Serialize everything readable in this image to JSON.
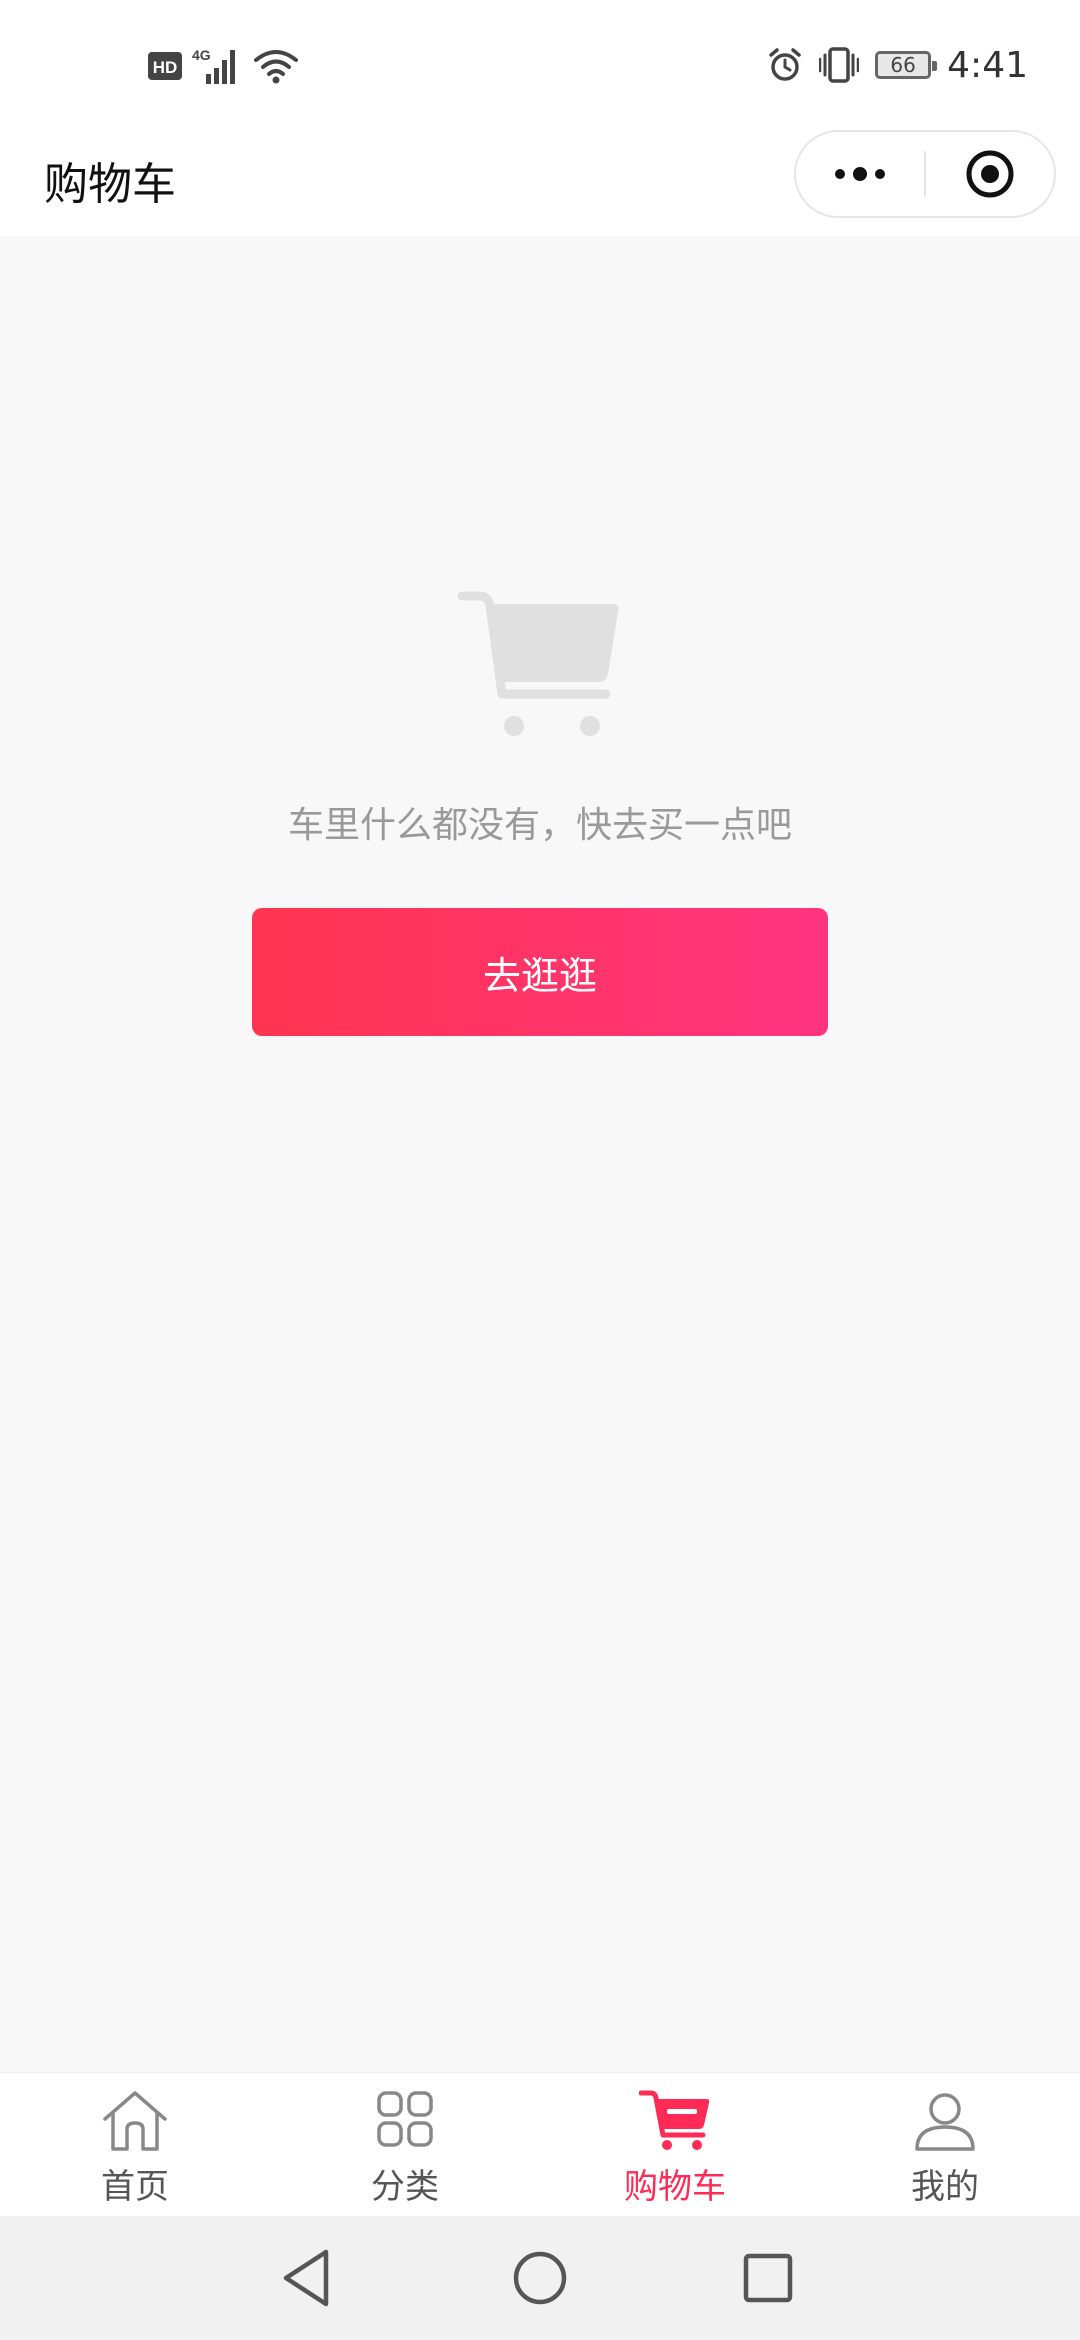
{
  "status_bar": {
    "time": "4:41",
    "battery_level": "66",
    "network_badge": "HD",
    "network_type": "4G",
    "icons": [
      "hd-icon",
      "4g-signal-icon",
      "wifi-icon",
      "alarm-icon",
      "vibrate-icon",
      "battery-icon"
    ]
  },
  "nav": {
    "title": "购物车",
    "capsule_icons": [
      "more-dots-icon",
      "close-target-icon"
    ]
  },
  "empty_state": {
    "icon": "empty-cart-icon",
    "message": "车里什么都没有，快去买一点吧",
    "button_label": "去逛逛"
  },
  "tabs": [
    {
      "label": "首页",
      "icon": "home-icon",
      "active": false
    },
    {
      "label": "分类",
      "icon": "grid-icon",
      "active": false
    },
    {
      "label": "购物车",
      "icon": "cart-icon",
      "active": true
    },
    {
      "label": "我的",
      "icon": "user-icon",
      "active": false
    }
  ],
  "colors": {
    "accent": "#ff2a56",
    "button_gradient_start": "#ff3450",
    "button_gradient_end": "#ff3480",
    "inactive_tab": "#555555",
    "page_background": "#f8f8f8"
  },
  "system_nav": [
    "back-triangle-icon",
    "home-circle-icon",
    "recents-square-icon"
  ]
}
